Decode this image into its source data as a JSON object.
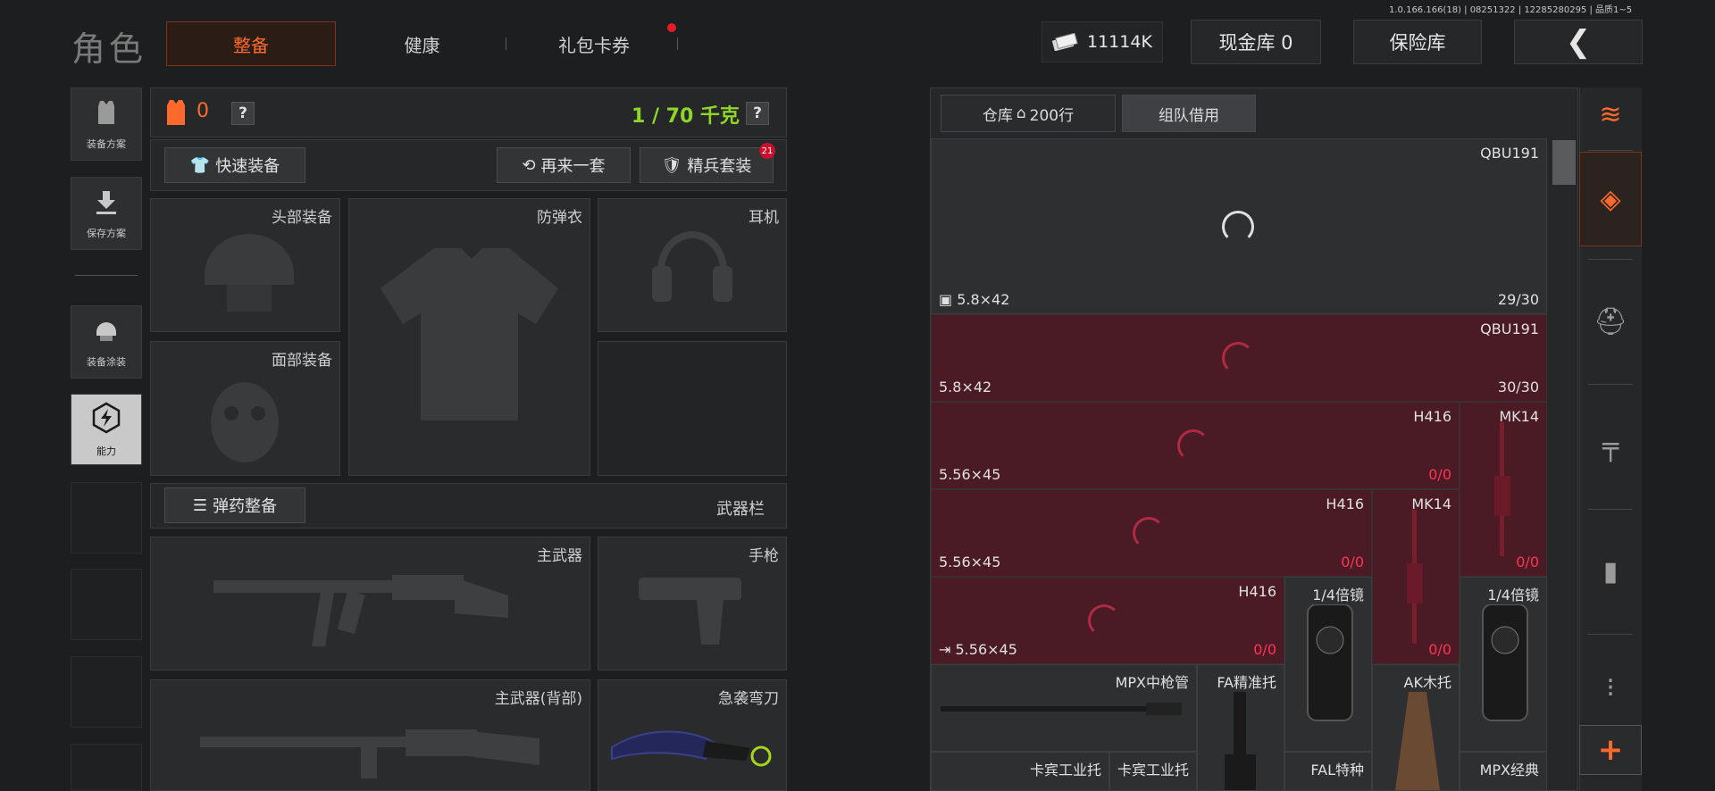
{
  "version_text": "1.0.166.166(18) | 08251322 | 12285280295 | 品质1~5",
  "header": {
    "title": "角色",
    "tabs": [
      {
        "label": "整备",
        "active": true
      },
      {
        "label": "健康",
        "active": false
      },
      {
        "label": "礼包卡券",
        "active": false,
        "badge_dot": true
      }
    ],
    "currency": {
      "icon": "cash-icon",
      "value": "11114K"
    },
    "cash_vault_label": "现金库 0",
    "safe_label": "保险库",
    "back_icon": "chevron-left-icon"
  },
  "left_sidebar": [
    {
      "label": "装备方案",
      "icon": "vest-icon",
      "active": false
    },
    {
      "label": "保存方案",
      "icon": "download-icon",
      "active": false
    },
    {
      "label": "装备涂装",
      "icon": "helmet-paint-icon",
      "active": false
    },
    {
      "label": "能力",
      "icon": "lightning-icon",
      "active": true
    }
  ],
  "equipment": {
    "armor_count": "0",
    "help": "?",
    "weight": "1 / 70 千克",
    "quick_equip": "快速装备",
    "again_label": "再来一套",
    "elite_label": "精兵套装",
    "elite_badge": "21",
    "slots": {
      "head": "头部装备",
      "armor": "防弹衣",
      "headset": "耳机",
      "face": "面部装备"
    },
    "ammo_label": "弹药整备",
    "weapon_bar": "武器栏",
    "weapon_slots": {
      "primary": "主武器",
      "pistol": "手枪",
      "primary_back": "主武器(背部)",
      "melee": "急袭弯刀"
    }
  },
  "storage": {
    "tab_warehouse": "仓库",
    "tab_rows": "200行",
    "tab_team": "组队借用",
    "items": [
      {
        "name": "QBU191",
        "caliber": "5.8×42",
        "durability": "29/30"
      },
      {
        "name": "QBU191",
        "caliber": "5.8×42",
        "durability": "30/30"
      },
      {
        "name": "H416",
        "caliber": "5.56×45",
        "durability_a": "0",
        "durability_b": "/0"
      },
      {
        "name": "MK14",
        "caliber": "",
        "durability_a": "0",
        "durability_b": "/0"
      },
      {
        "name": "H416",
        "caliber": "5.56×45",
        "durability_a": "0",
        "durability_b": "/0"
      },
      {
        "name": "MK14",
        "caliber": "",
        "durability_a": "0",
        "durability_b": "/0"
      },
      {
        "name": "H416",
        "caliber": "5.56×45",
        "durability_a": "0",
        "durability_b": "/0"
      },
      {
        "name": "1/4倍镜"
      },
      {
        "name": "1/4倍镜"
      },
      {
        "name": "MPX中枪管"
      },
      {
        "name": "FA精准托"
      },
      {
        "name": "AK木托"
      },
      {
        "name": "卡宾工业托"
      },
      {
        "name": "卡宾工业托"
      },
      {
        "name": "FAL特种"
      },
      {
        "name": "MPX经典"
      }
    ]
  },
  "right_sidebar": [
    "stack-icon",
    "layers-icon",
    "helmet-icon",
    "rifle-icon",
    "magazine-icon",
    "bullet-icon",
    "plus-icon"
  ],
  "colors": {
    "accent": "#ff6a2c",
    "weight_green": "#8fd629",
    "item_red": "#4e1c25",
    "durability_red": "#ff3455"
  }
}
